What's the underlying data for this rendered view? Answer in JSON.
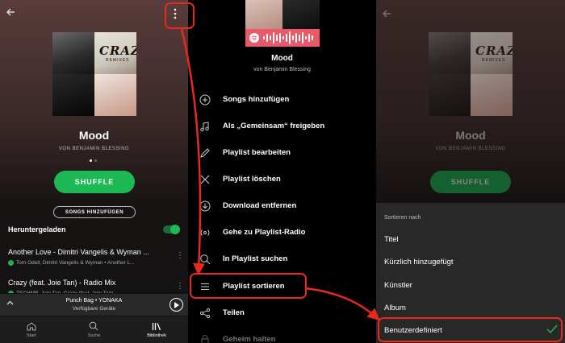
{
  "panel1": {
    "playlist_title": "Mood",
    "playlist_owner": "VON BENJAMIN BLESSING",
    "cover_text": [
      "CRAZY",
      "REMIXES"
    ],
    "shuffle_label": "SHUFFLE",
    "add_songs_label": "SONGS HINZUFÜGEN",
    "downloaded_label": "Heruntergeladen",
    "tracks": [
      {
        "title": "Another Love - Dimitri Vangelis & Wyman ...",
        "artists": "Tom Odell, Dimitri Vangelis & Wyman • Another L..."
      },
      {
        "title": "Crazy (feat. Joie Tan) - Radio Mix",
        "artists": "TECHMB, Joie Tan, Crazy (feat. Joie Tan) ..."
      }
    ],
    "mini_player": {
      "song": "Punch Bag • YONAKA",
      "device": "Verfügbare Geräte"
    },
    "nav": [
      "Start",
      "Suche",
      "Bibliothek"
    ]
  },
  "panel2": {
    "playlist_title": "Mood",
    "playlist_owner": "von Benjamin Blessing",
    "menu": [
      {
        "label": "Songs hinzufügen",
        "icon": "plus-circle-icon"
      },
      {
        "label": "Als „Gemeinsam“ freigeben",
        "icon": "music-note-icon"
      },
      {
        "label": "Playlist bearbeiten",
        "icon": "pencil-icon"
      },
      {
        "label": "Playlist löschen",
        "icon": "x-icon"
      },
      {
        "label": "Download entfernen",
        "icon": "download-circle-icon"
      },
      {
        "label": "Gehe zu Playlist-Radio",
        "icon": "radio-icon"
      },
      {
        "label": "In Playlist suchen",
        "icon": "search-icon"
      },
      {
        "label": "Playlist sortieren",
        "icon": "hamburger-icon"
      },
      {
        "label": "Teilen",
        "icon": "share-icon"
      },
      {
        "label": "Geheim halten",
        "icon": "lock-icon"
      }
    ]
  },
  "panel3": {
    "playlist_title": "Mood",
    "playlist_owner": "VON BENJAMIN BLESSING",
    "shuffle_label": "SHUFFLE",
    "sheet_title": "Sortieren nach",
    "sort_options": [
      "Titel",
      "Kürzlich hinzugefügt",
      "Künstler",
      "Album",
      "Benutzerdefiniert"
    ],
    "selected_option": "Benutzerdefiniert"
  },
  "colors": {
    "accent": "#1db954",
    "callout": "#e8291c",
    "spotify_code": "#e8596a"
  }
}
